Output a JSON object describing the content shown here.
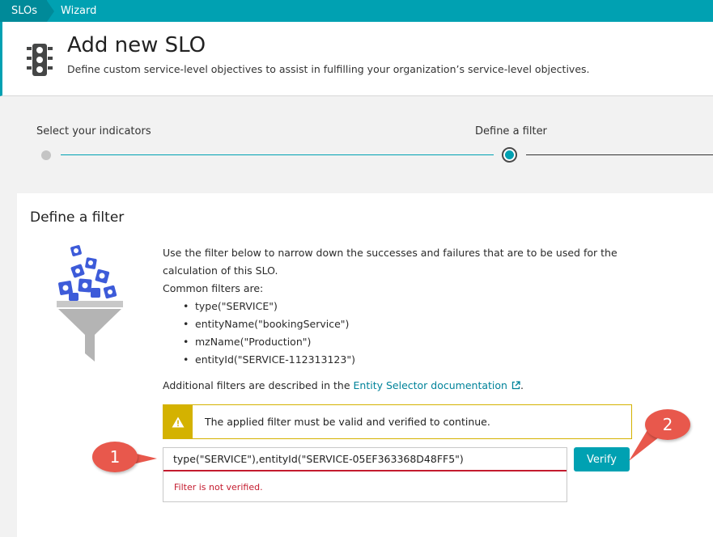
{
  "breadcrumb": {
    "items": [
      "SLOs",
      "Wizard"
    ]
  },
  "header": {
    "title": "Add new SLO",
    "subtitle": "Define custom service-level objectives to assist in fulfilling your organization’s service-level objectives.",
    "icon": "traffic-light-icon"
  },
  "stepper": {
    "steps": [
      {
        "label": "Select your indicators",
        "state": "completed"
      },
      {
        "label": "Define a filter",
        "state": "active"
      }
    ]
  },
  "card": {
    "title": "Define a filter",
    "intro": "Use the filter below to narrow down the successes and failures that are to be used for the calculation of this SLO.",
    "common_label": "Common filters are:",
    "examples": [
      "type(\"SERVICE\")",
      "entityName(\"bookingService\")",
      "mzName(\"Production\")",
      "entityId(\"SERVICE-112313123\")"
    ],
    "additional_prefix": "Additional filters are described in the ",
    "doc_link": "Entity Selector documentation",
    "additional_suffix": ".",
    "warning": "The applied filter must be valid and verified to continue.",
    "filter_value": "type(\"SERVICE\"),entityId(\"SERVICE-05EF363368D48FF5\")",
    "filter_error": "Filter is not verified.",
    "verify_label": "Verify"
  },
  "callouts": [
    "1",
    "2"
  ],
  "colors": {
    "accent": "#00a1b2",
    "warning": "#d4b200",
    "error": "#c41b2e",
    "callout": "#e8584c"
  }
}
